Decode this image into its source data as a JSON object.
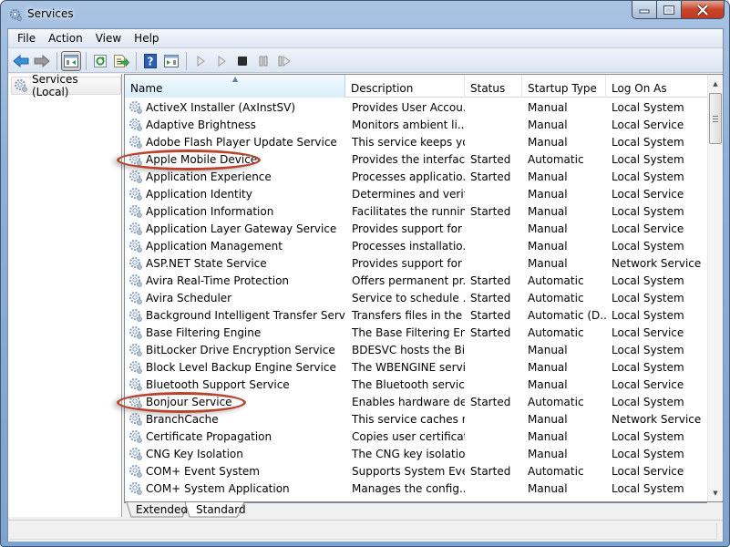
{
  "window": {
    "title": "Services",
    "controls": {
      "minimize": "minimize",
      "maximize": "maximize",
      "close": "close"
    }
  },
  "menu": [
    "File",
    "Action",
    "View",
    "Help"
  ],
  "toolbar": {
    "buttons": [
      "back-arrow-icon",
      "forward-arrow-icon",
      "show-hide-console-tree-icon",
      "refresh-icon",
      "export-list-icon",
      "help-icon",
      "show-hide-action-pane-icon",
      "start-service-icon",
      "start-service-alt-icon",
      "stop-service-icon",
      "pause-service-icon",
      "restart-service-icon"
    ]
  },
  "tree": {
    "root": "Services (Local)"
  },
  "table": {
    "columns": [
      "Name",
      "Description",
      "Status",
      "Startup Type",
      "Log On As"
    ],
    "sorted_column": "Name",
    "rows": [
      {
        "name": "ActiveX Installer (AxInstSV)",
        "description": "Provides User Accou...",
        "status": "",
        "startup": "Manual",
        "logon": "Local System"
      },
      {
        "name": "Adaptive Brightness",
        "description": "Monitors ambient li...",
        "status": "",
        "startup": "Manual",
        "logon": "Local Service"
      },
      {
        "name": "Adobe Flash Player Update Service",
        "description": "This service keeps yo...",
        "status": "",
        "startup": "Manual",
        "logon": "Local System"
      },
      {
        "name": "Apple Mobile Device",
        "description": "Provides the interfac...",
        "status": "Started",
        "startup": "Automatic",
        "logon": "Local System"
      },
      {
        "name": "Application Experience",
        "description": "Processes applicatio...",
        "status": "Started",
        "startup": "Manual",
        "logon": "Local System"
      },
      {
        "name": "Application Identity",
        "description": "Determines and verif...",
        "status": "",
        "startup": "Manual",
        "logon": "Local Service"
      },
      {
        "name": "Application Information",
        "description": "Facilitates the runnin...",
        "status": "Started",
        "startup": "Manual",
        "logon": "Local System"
      },
      {
        "name": "Application Layer Gateway Service",
        "description": "Provides support for ...",
        "status": "",
        "startup": "Manual",
        "logon": "Local Service"
      },
      {
        "name": "Application Management",
        "description": "Processes installatio...",
        "status": "",
        "startup": "Manual",
        "logon": "Local System"
      },
      {
        "name": "ASP.NET State Service",
        "description": "Provides support for ...",
        "status": "",
        "startup": "Manual",
        "logon": "Network Service"
      },
      {
        "name": "Avira Real-Time Protection",
        "description": "Offers permanent pr...",
        "status": "Started",
        "startup": "Automatic",
        "logon": "Local System"
      },
      {
        "name": "Avira Scheduler",
        "description": "Service to schedule ...",
        "status": "Started",
        "startup": "Automatic",
        "logon": "Local System"
      },
      {
        "name": "Background Intelligent Transfer Service",
        "description": "Transfers files in the ...",
        "status": "Started",
        "startup": "Automatic (D...",
        "logon": "Local System"
      },
      {
        "name": "Base Filtering Engine",
        "description": "The Base Filtering En...",
        "status": "Started",
        "startup": "Automatic",
        "logon": "Local Service"
      },
      {
        "name": "BitLocker Drive Encryption Service",
        "description": "BDESVC hosts the Bit...",
        "status": "",
        "startup": "Manual",
        "logon": "Local System"
      },
      {
        "name": "Block Level Backup Engine Service",
        "description": "The WBENGINE servi...",
        "status": "",
        "startup": "Manual",
        "logon": "Local System"
      },
      {
        "name": "Bluetooth Support Service",
        "description": "The Bluetooth servic...",
        "status": "",
        "startup": "Manual",
        "logon": "Local Service"
      },
      {
        "name": "Bonjour Service",
        "description": "Enables hardware de...",
        "status": "Started",
        "startup": "Automatic",
        "logon": "Local System"
      },
      {
        "name": "BranchCache",
        "description": "This service caches n...",
        "status": "",
        "startup": "Manual",
        "logon": "Network Service"
      },
      {
        "name": "Certificate Propagation",
        "description": "Copies user certificat...",
        "status": "",
        "startup": "Manual",
        "logon": "Local System"
      },
      {
        "name": "CNG Key Isolation",
        "description": "The CNG key isolatio...",
        "status": "",
        "startup": "Manual",
        "logon": "Local System"
      },
      {
        "name": "COM+ Event System",
        "description": "Supports System Eve...",
        "status": "Started",
        "startup": "Automatic",
        "logon": "Local Service"
      },
      {
        "name": "COM+ System Application",
        "description": "Manages the config...",
        "status": "",
        "startup": "Manual",
        "logon": "Local System"
      }
    ]
  },
  "highlighted_rows": [
    "Apple Mobile Device",
    "Bonjour Service"
  ],
  "tabs": [
    {
      "label": "Extended",
      "active": false
    },
    {
      "label": "Standard",
      "active": true
    }
  ],
  "colors": {
    "highlight_ellipse": "#b8432f",
    "title_bar": "#8fb0d8",
    "close_button": "#c8442a"
  }
}
